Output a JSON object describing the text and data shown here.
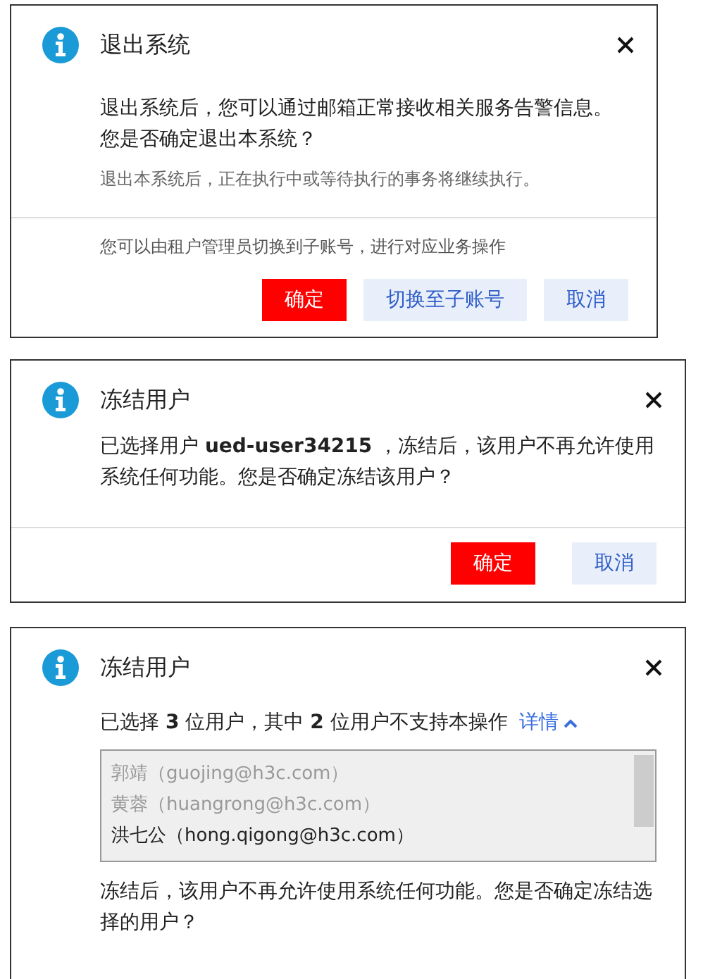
{
  "dialogs": [
    {
      "title": "退出系统",
      "message": "退出系统后，您可以通过邮箱正常接收相关服务告警信息。您是否确定退出本系统？",
      "note": "退出本系统后，正在执行中或等待执行的事务将继续执行。",
      "footer_note": "您可以由租户管理员切换到子账号，进行对应业务操作",
      "buttons": [
        {
          "label": "确定",
          "kind": "primary"
        },
        {
          "label": "切换至子账号",
          "kind": "secondary"
        },
        {
          "label": "取消",
          "kind": "secondary"
        }
      ]
    },
    {
      "title": "冻结用户",
      "message": "已选择用户 **ued-user34215** ，冻结后，该用户不再允许使用系统任何功能。您是否确定冻结该用户？",
      "buttons": [
        {
          "label": "确定",
          "kind": "primary"
        },
        {
          "label": "取消",
          "kind": "secondary"
        }
      ]
    },
    {
      "title": "冻结用户",
      "message": "已选择 **3** 位用户，其中 **2** 位用户不支持本操作",
      "details": {
        "label": "详情",
        "expanded": true
      },
      "users": [
        {
          "text": "郭靖（guojing@h3c.com）",
          "disabled": true
        },
        {
          "text": "黄蓉（huangrong@h3c.com）",
          "disabled": true
        },
        {
          "text": "洪七公（hong.qigong@h3c.com）",
          "disabled": false
        }
      ],
      "question": "冻结后，该用户不再允许使用系统任何功能。您是否确定冻结选择的用户？"
    }
  ]
}
